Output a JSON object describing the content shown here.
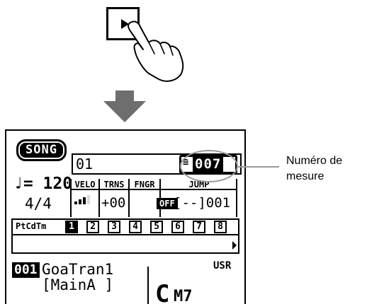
{
  "song": {
    "badge": "SONG",
    "title_value": "01",
    "measure_prefix": "≘",
    "measure_number": "007"
  },
  "tempo": {
    "label": "♩= 120",
    "time_signature": "4/4"
  },
  "params": {
    "velo": {
      "header": "VELO",
      "level": 0.8
    },
    "trns": {
      "header": "TRNS",
      "value": "+00"
    },
    "fngr": {
      "header": "FNGR",
      "value": "OFF"
    },
    "jump": {
      "header": "JUMP",
      "value": "[--]001"
    }
  },
  "tracks": {
    "label": "PtCdTm",
    "items": [
      "1",
      "2",
      "3",
      "4",
      "5",
      "6",
      "7",
      "8"
    ],
    "active_index": 0
  },
  "bottom": {
    "song_number": "001",
    "style_name": "GoaTran1",
    "section": "[MainA ]",
    "chord_root": "C",
    "chord_quality": "M7",
    "bank": "USR"
  },
  "callout": {
    "line1": "Numéro de",
    "line2": "mesure"
  },
  "colors": {
    "lcd_fg": "#000000",
    "lcd_bg": "#ffffff",
    "arrow": "#6e6e6e",
    "callout": "#9a9a9a"
  },
  "icons": {
    "play": "play-icon",
    "hand": "pointing-hand-icon",
    "arrow": "down-arrow-icon"
  }
}
